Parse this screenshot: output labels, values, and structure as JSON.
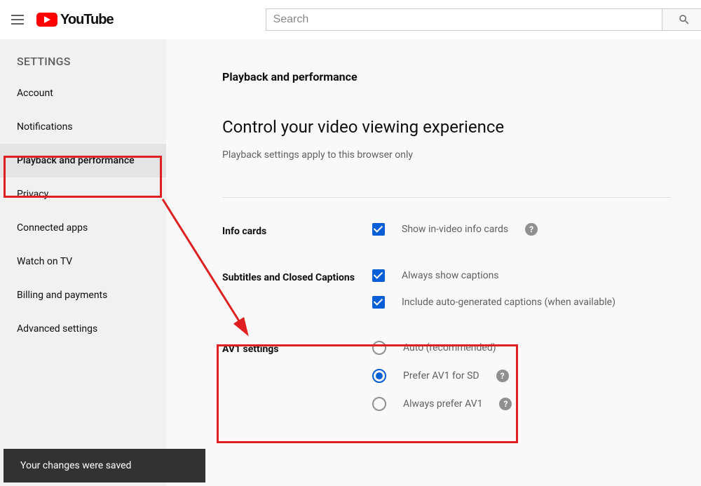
{
  "header": {
    "logo_text": "YouTube",
    "search_placeholder": "Search"
  },
  "sidebar": {
    "heading": "SETTINGS",
    "items": [
      {
        "label": "Account"
      },
      {
        "label": "Notifications"
      },
      {
        "label": "Playback and performance"
      },
      {
        "label": "Privacy"
      },
      {
        "label": "Connected apps"
      },
      {
        "label": "Watch on TV"
      },
      {
        "label": "Billing and payments"
      },
      {
        "label": "Advanced settings"
      }
    ]
  },
  "main": {
    "subtitle": "Playback and performance",
    "title": "Control your video viewing experience",
    "description": "Playback settings apply to this browser only",
    "sections": {
      "info_cards": {
        "label": "Info cards",
        "opt1": "Show in-video info cards"
      },
      "subtitles": {
        "label": "Subtitles and Closed Captions",
        "opt1": "Always show captions",
        "opt2": "Include auto-generated captions (when available)"
      },
      "av1": {
        "label": "AV1 settings",
        "opt1": "Auto (recommended)",
        "opt2": "Prefer AV1 for SD",
        "opt3": "Always prefer AV1"
      }
    }
  },
  "toast": {
    "message": "Your changes were saved"
  },
  "help_glyph": "?"
}
